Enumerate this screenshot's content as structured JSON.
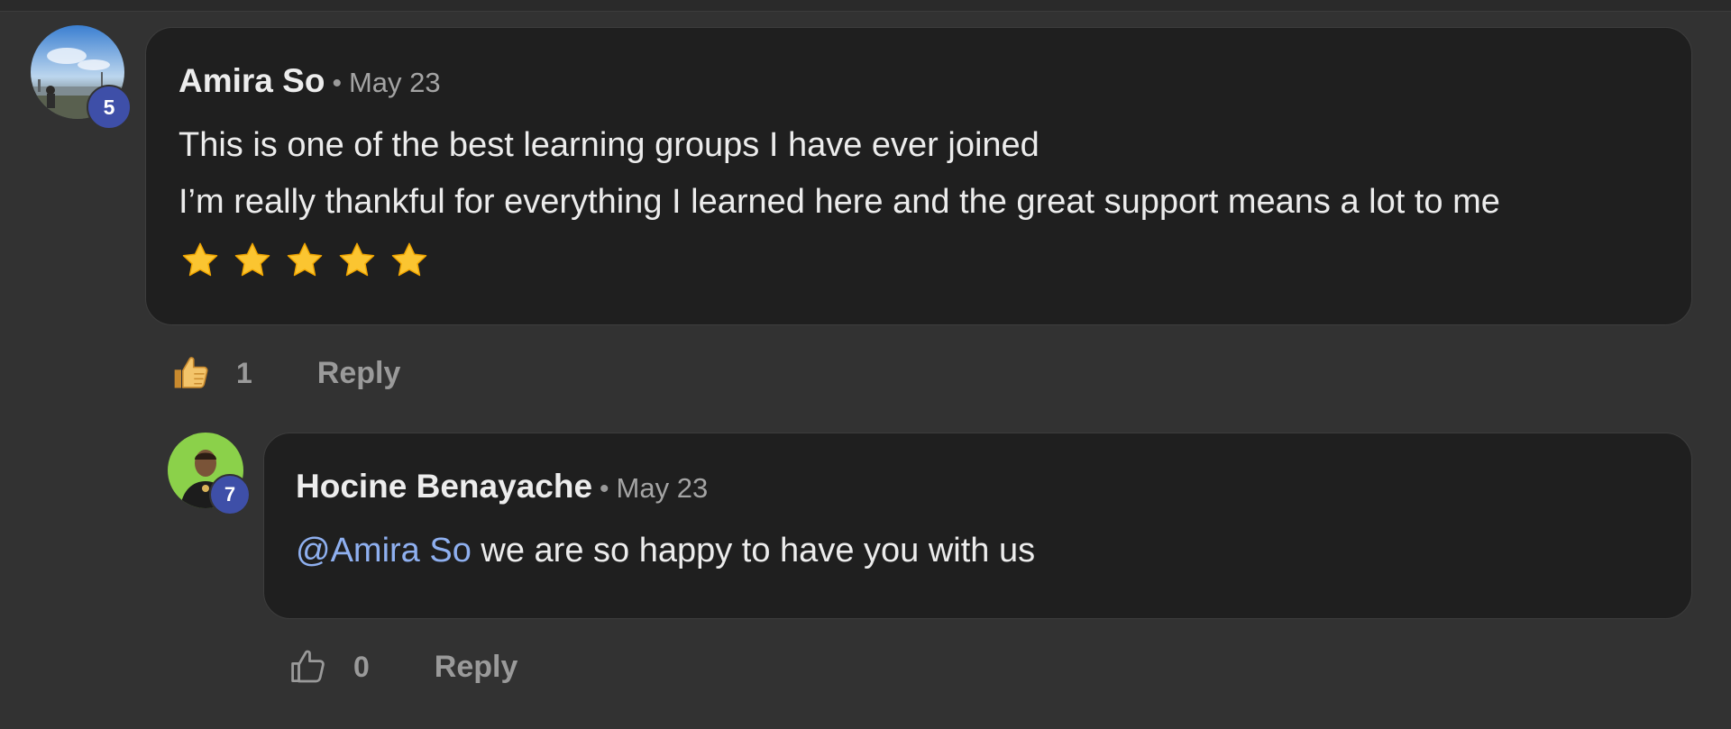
{
  "comments": [
    {
      "author": "Amira So",
      "date": "May 23",
      "separator": "•",
      "level": "5",
      "lines": [
        "This is one of the best learning groups I have ever joined",
        "I’m really thankful for everything I learned here and the great support means a lot to me"
      ],
      "stars": 5,
      "likes": "1",
      "liked": true,
      "reply_label": "Reply"
    },
    {
      "author": "Hocine Benayache",
      "date": "May 23",
      "separator": "•",
      "level": "7",
      "mention": "@Amira So",
      "text": " we are so happy to have you with us",
      "likes": "0",
      "liked": false,
      "reply_label": "Reply"
    }
  ],
  "colors": {
    "background": "#323232",
    "bubble": "#1f1f1f",
    "mention": "#8fb0f0",
    "badge": "#3e4fa8",
    "liked_thumb": "#f3c46a"
  },
  "icons": {
    "like": "thumbs-up-icon",
    "star": "star-icon"
  }
}
